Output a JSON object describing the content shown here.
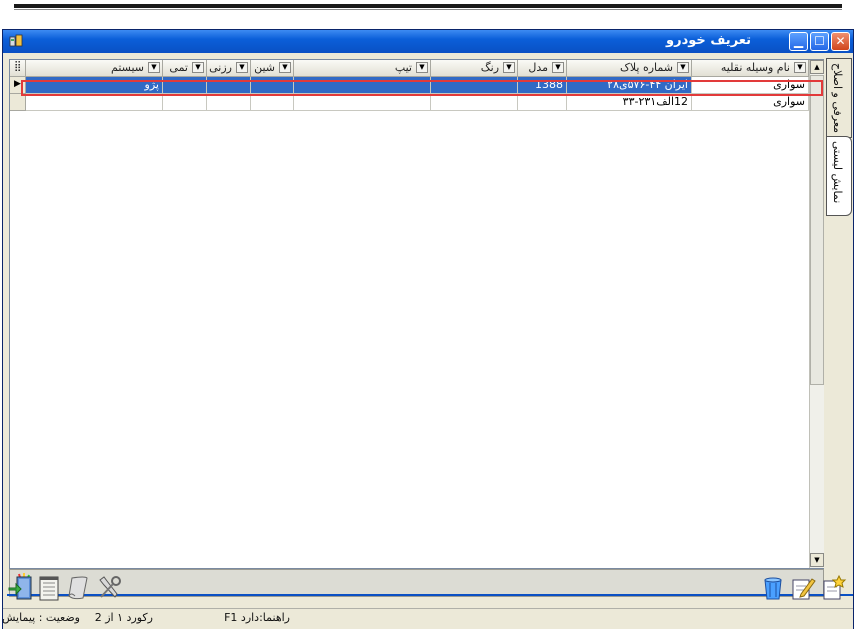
{
  "window": {
    "title": "تعریف خودرو",
    "buttons": {
      "close": "✕",
      "maximize": "☐",
      "minimize": "▁"
    }
  },
  "grid": {
    "columns": [
      {
        "label": "نام وسیله نقلیه"
      },
      {
        "label": "شماره پلاک"
      },
      {
        "label": "مدل"
      },
      {
        "label": "رنگ"
      },
      {
        "label": "تیپ"
      },
      {
        "label": "شین"
      },
      {
        "label": "رزنی"
      },
      {
        "label": "تمی"
      },
      {
        "label": "سیستم"
      }
    ],
    "rows": [
      {
        "cells": [
          "سواری",
          "ایران ۴۴-۵۷۶ی۲۸",
          "1388",
          "",
          "",
          "",
          "",
          "",
          "پژو"
        ]
      },
      {
        "cells": [
          "سواری",
          "12الف۲۳۱-۳۳",
          "",
          "",
          "",
          "",
          "",
          "",
          ""
        ]
      }
    ]
  },
  "side_tabs": [
    "معرفی و اصلاح",
    "نمایش لیستی"
  ],
  "statusbar": {
    "help": "راهنما:دارد F1",
    "record": "رکورد ۱ از 2",
    "status": "وضعیت : پیمایش"
  },
  "icons": {
    "app": "car-app-icon",
    "toolbar_left": [
      "exit-icon",
      "notebook-icon",
      "scroll-icon",
      "tools-icon"
    ],
    "toolbar_right": [
      "delete-icon",
      "edit-icon",
      "new-icon"
    ],
    "lower_panel": "pencil-cup-icon"
  },
  "colors": {
    "titlebar": "#0b5fd9",
    "selection": "#316ac5",
    "highlight_box": "#e23a3a"
  }
}
